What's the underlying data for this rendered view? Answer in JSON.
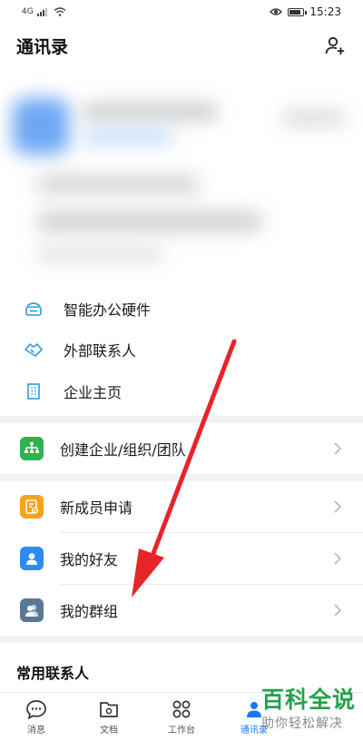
{
  "status_bar": {
    "network": "4G",
    "time": "15:23",
    "battery_level": 0.85
  },
  "header": {
    "title": "通讯录"
  },
  "quick_items": [
    {
      "label": "智能办公硬件",
      "icon": "hardware-icon"
    },
    {
      "label": "外部联系人",
      "icon": "handshake-icon"
    },
    {
      "label": "企业主页",
      "icon": "building-icon"
    }
  ],
  "create_org": {
    "label": "创建企业/组织/团队",
    "icon": "org-chart-icon",
    "color": "#2fb350"
  },
  "contact_items": [
    {
      "label": "新成员申请",
      "icon": "new-member-icon",
      "color": "#f5a31a"
    },
    {
      "label": "我的好友",
      "icon": "friend-icon",
      "color": "#2d8cf0"
    },
    {
      "label": "我的群组",
      "icon": "group-icon",
      "color": "#5b7896"
    }
  ],
  "section": {
    "frequent_contacts": "常用联系人"
  },
  "bottom_nav": [
    {
      "label": "消息",
      "icon": "message-icon"
    },
    {
      "label": "文档",
      "icon": "document-icon"
    },
    {
      "label": "工作台",
      "icon": "workbench-icon"
    },
    {
      "label": "通讯录",
      "icon": "contacts-icon",
      "active": true
    }
  ],
  "watermark": {
    "main": "百科全说",
    "sub": "助你轻松解决"
  },
  "colors": {
    "accent": "#1677ff",
    "arrow": "#e8242a",
    "watermark_green": "#23a24d"
  }
}
